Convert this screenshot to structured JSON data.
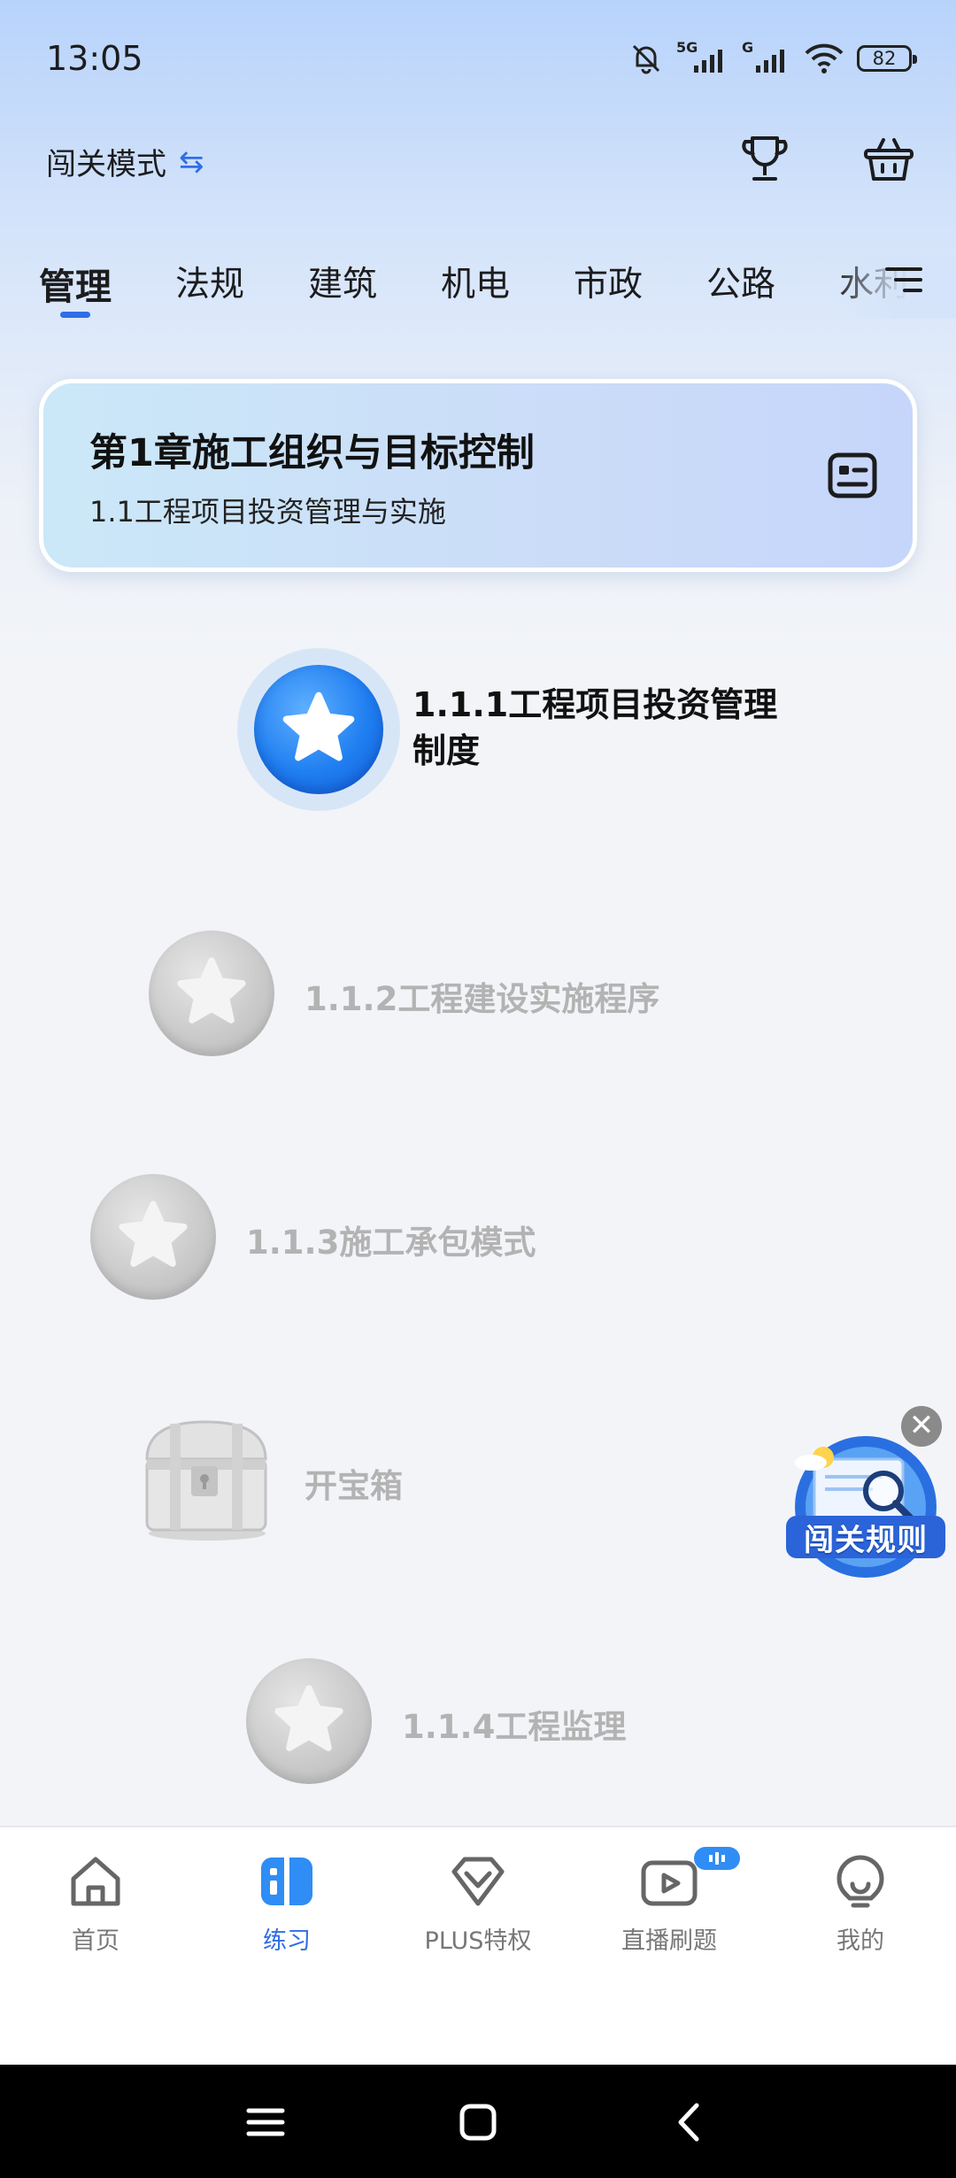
{
  "status_bar": {
    "time": "13:05",
    "battery": "82",
    "net1": "5G",
    "net2": "G"
  },
  "header": {
    "mode_label": "闯关模式",
    "mode_switch_glyph": "⇆",
    "trophy_icon": "trophy-icon",
    "basket_icon": "basket-icon"
  },
  "tabs": [
    {
      "label": "管理",
      "active": true
    },
    {
      "label": "法规"
    },
    {
      "label": "建筑"
    },
    {
      "label": "机电"
    },
    {
      "label": "市政"
    },
    {
      "label": "公路"
    },
    {
      "label": "水利"
    }
  ],
  "chapter_card": {
    "title": "第1章施工组织与目标控制",
    "subtitle": "1.1工程项目投资管理与实施"
  },
  "path_nodes": [
    {
      "label": "1.1.1工程项目投资管理制度",
      "state": "active"
    },
    {
      "label": "1.1.2工程建设实施程序",
      "state": "locked"
    },
    {
      "label": "1.1.3施工承包模式",
      "state": "locked"
    },
    {
      "label": "开宝箱",
      "state": "treasure-chest"
    },
    {
      "label": "1.1.4工程监理",
      "state": "locked"
    }
  ],
  "floating_badge": {
    "label": "闯关规则",
    "close_glyph": "✕"
  },
  "bottom_nav": [
    {
      "label": "首页",
      "icon": "home-icon"
    },
    {
      "label": "练习",
      "icon": "practice-icon",
      "active": true
    },
    {
      "label": "PLUS特权",
      "icon": "diamond-icon"
    },
    {
      "label": "直播刷题",
      "icon": "live-icon"
    },
    {
      "label": "我的",
      "icon": "profile-icon"
    }
  ],
  "colors": {
    "accent": "#2f6ee6",
    "locked_text": "#b3b3b3",
    "active_node": "#1f7ef0"
  }
}
